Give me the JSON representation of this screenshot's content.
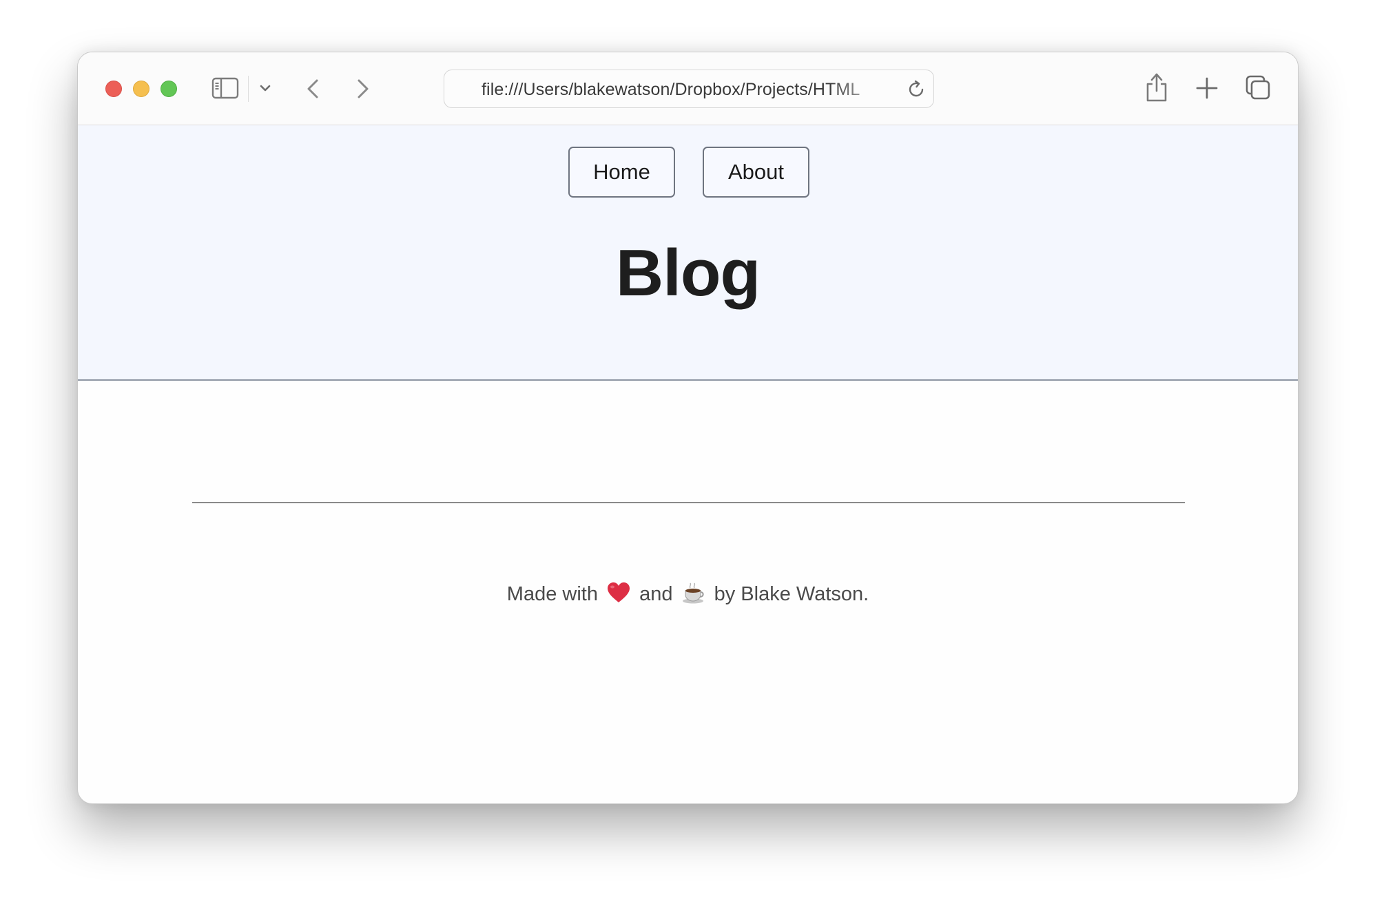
{
  "browser": {
    "address_url": "file:///Users/blakewatson/Dropbox/Projects/HTML",
    "icons": [
      "sidebar-icon",
      "chevron-down-icon",
      "back-icon",
      "forward-icon",
      "reload-icon",
      "share-icon",
      "plus-icon",
      "tabs-icon"
    ]
  },
  "nav": {
    "home_label": "Home",
    "about_label": "About"
  },
  "header": {
    "title": "Blog",
    "background": "#f4f7fe"
  },
  "footer": {
    "made_with": "Made with",
    "and": "and",
    "by": "by Blake Watson.",
    "icons": [
      "heart-icon",
      "coffee-icon"
    ]
  }
}
